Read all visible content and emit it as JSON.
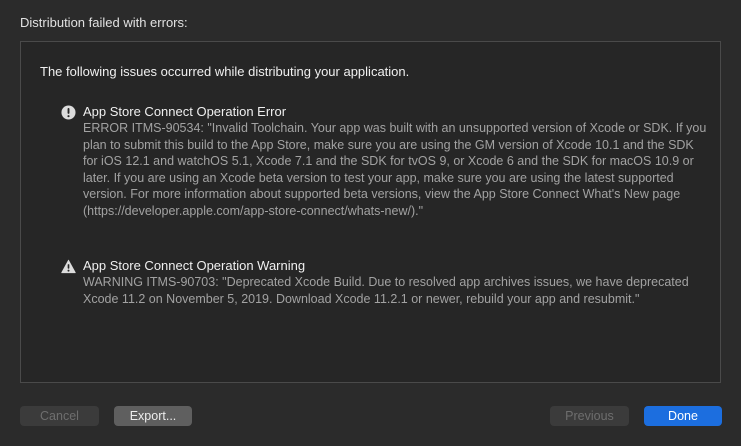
{
  "dialog": {
    "title": "Distribution failed with errors:"
  },
  "panel": {
    "intro": "The following issues occurred while distributing your application.",
    "issues": [
      {
        "icon": "error-icon",
        "title": "App Store Connect Operation Error",
        "body": "ERROR ITMS-90534: \"Invalid Toolchain. Your app was built with an unsupported version of Xcode or SDK. If you plan to submit this build to the App Store, make sure you are using the GM version of Xcode 10.1 and the SDK for iOS 12.1 and watchOS 5.1, Xcode 7.1 and the SDK for tvOS 9, or Xcode 6 and the SDK for macOS 10.9 or later. If you are using an Xcode beta version to test your app, make sure you are using the latest supported version. For more information about supported beta versions, view the App Store Connect What's New page (https://developer.apple.com/app-store-connect/whats-new/).\""
      },
      {
        "icon": "warning-icon",
        "title": "App Store Connect Operation Warning",
        "body": "WARNING ITMS-90703: \"Deprecated Xcode Build. Due to resolved app archives issues, we have deprecated Xcode 11.2 on November 5, 2019. Download Xcode 11.2.1 or newer, rebuild your app and resubmit.\""
      }
    ]
  },
  "buttons": {
    "cancel": "Cancel",
    "export": "Export...",
    "previous": "Previous",
    "done": "Done"
  },
  "colors": {
    "background": "#2b2b2b",
    "panel": "#262626",
    "accent": "#1c6edf"
  }
}
